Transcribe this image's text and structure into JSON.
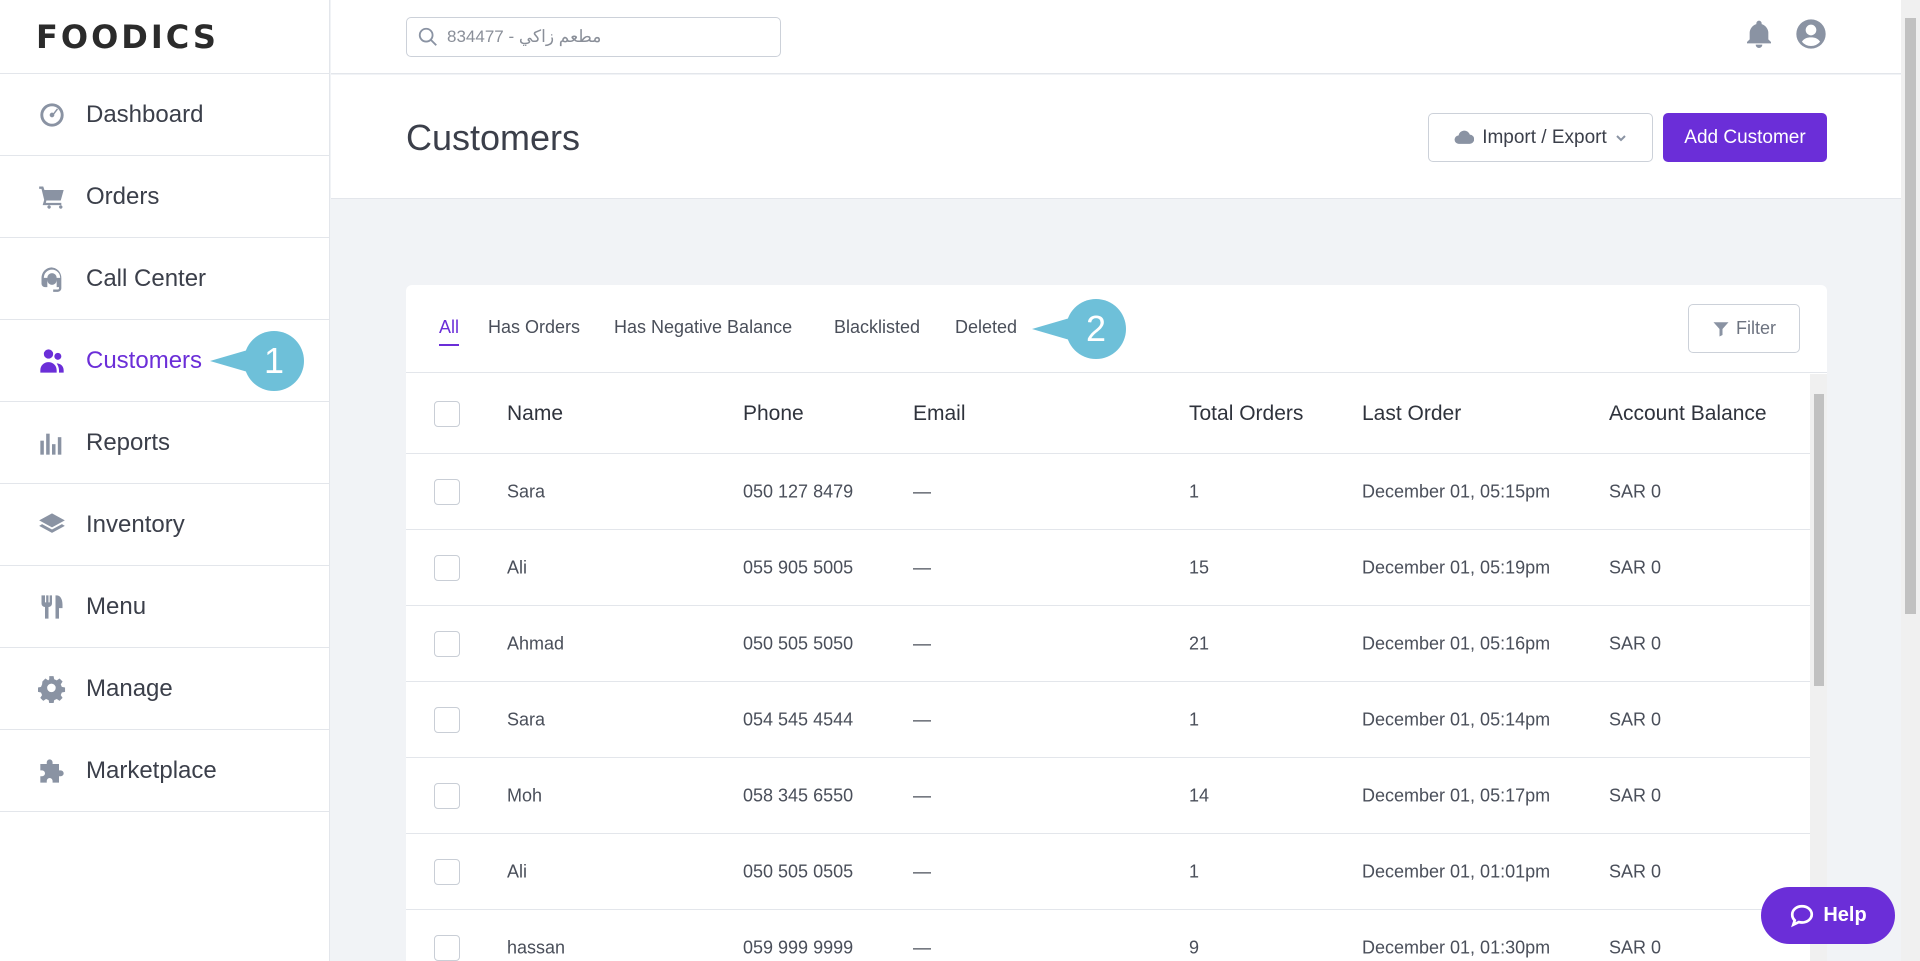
{
  "app": {
    "logo_text": "FOODICS"
  },
  "search": {
    "placeholder": "834477 - مطعم زاكي"
  },
  "sidebar": {
    "items": [
      {
        "label": "Dashboard",
        "icon": "dashboard-icon"
      },
      {
        "label": "Orders",
        "icon": "cart-icon"
      },
      {
        "label": "Call Center",
        "icon": "headset-icon"
      },
      {
        "label": "Customers",
        "icon": "users-icon",
        "active": true
      },
      {
        "label": "Reports",
        "icon": "bar-chart-icon"
      },
      {
        "label": "Inventory",
        "icon": "layers-icon"
      },
      {
        "label": "Menu",
        "icon": "utensils-icon"
      },
      {
        "label": "Manage",
        "icon": "gear-icon"
      },
      {
        "label": "Marketplace",
        "icon": "puzzle-icon"
      }
    ]
  },
  "callouts": {
    "one": "1",
    "two": "2"
  },
  "header": {
    "title": "Customers",
    "import_export_label": "Import / Export",
    "add_customer_label": "Add Customer"
  },
  "tabs": {
    "items": [
      "All",
      "Has Orders",
      "Has Negative Balance",
      "Blacklisted",
      "Deleted"
    ],
    "active": "All",
    "filter_label": "Filter"
  },
  "table": {
    "columns": [
      "Name",
      "Phone",
      "Email",
      "Total Orders",
      "Last Order",
      "Account Balance"
    ],
    "rows": [
      {
        "name": "Sara",
        "phone": "050 127 8479",
        "email": "—",
        "total_orders": "1",
        "last_order": "December 01, 05:15pm",
        "balance": "SAR 0"
      },
      {
        "name": "Ali",
        "phone": "055 905 5005",
        "email": "—",
        "total_orders": "15",
        "last_order": "December 01, 05:19pm",
        "balance": "SAR 0"
      },
      {
        "name": "Ahmad",
        "phone": "050 505 5050",
        "email": "—",
        "total_orders": "21",
        "last_order": "December 01, 05:16pm",
        "balance": "SAR 0"
      },
      {
        "name": "Sara",
        "phone": "054 545 4544",
        "email": "—",
        "total_orders": "1",
        "last_order": "December 01, 05:14pm",
        "balance": "SAR 0"
      },
      {
        "name": "Moh",
        "phone": "058 345 6550",
        "email": "—",
        "total_orders": "14",
        "last_order": "December 01, 05:17pm",
        "balance": "SAR 0"
      },
      {
        "name": "Ali",
        "phone": "050 505 0505",
        "email": "—",
        "total_orders": "1",
        "last_order": "December 01, 01:01pm",
        "balance": "SAR 0"
      },
      {
        "name": "hassan",
        "phone": "059 999 9999",
        "email": "—",
        "total_orders": "9",
        "last_order": "December 01, 01:30pm",
        "balance": "SAR 0"
      }
    ]
  },
  "help": {
    "label": "Help"
  },
  "colors": {
    "accent": "#6b2ed8",
    "callout": "#6ec0d9",
    "icon": "#8a93a3"
  }
}
